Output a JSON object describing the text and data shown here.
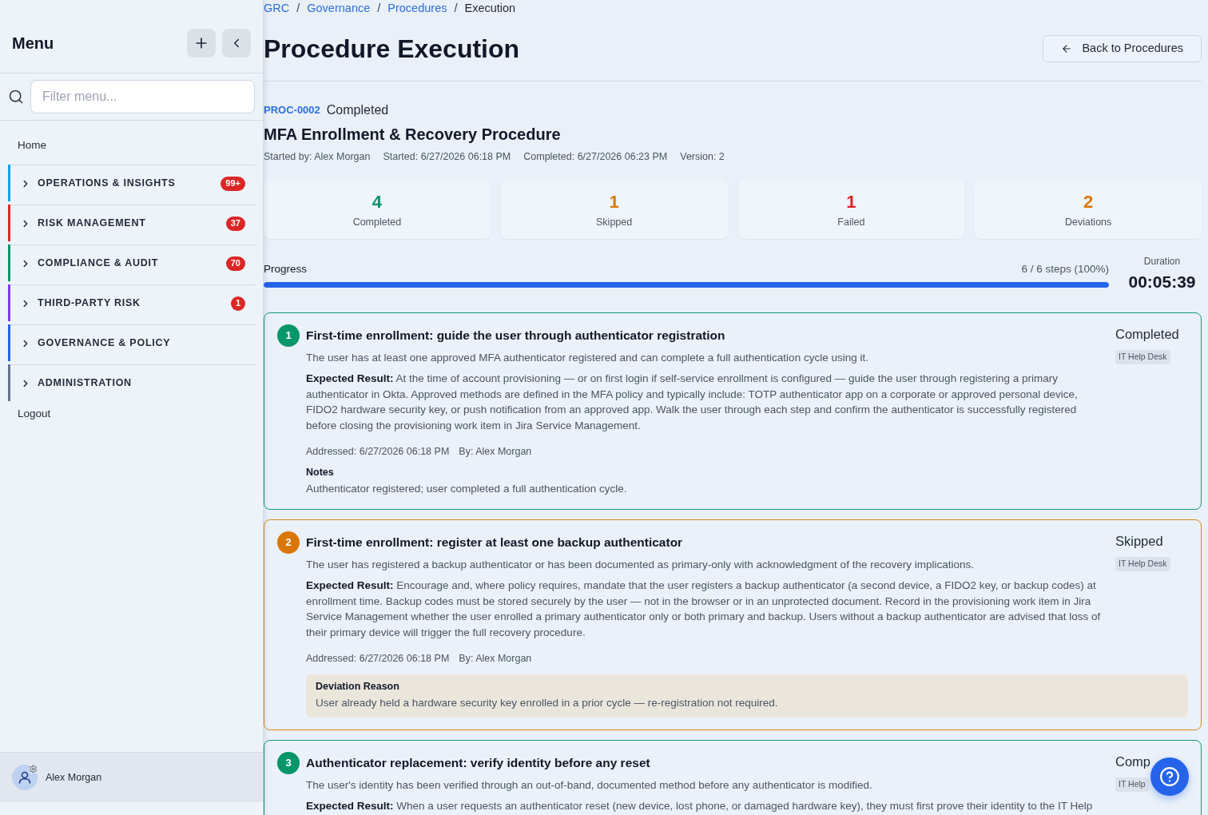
{
  "sidebar": {
    "title": "Menu",
    "filter": {
      "placeholder": "Filter menu..."
    },
    "items": [
      {
        "kind": "link",
        "label": "Home"
      },
      {
        "kind": "section",
        "label": "OPERATIONS & INSIGHTS",
        "badge": "99+",
        "color": "#0ea5e9",
        "expanded": false
      },
      {
        "kind": "section",
        "label": "RISK MANAGEMENT",
        "badge": "37",
        "color": "#dc2626",
        "expanded": false
      },
      {
        "kind": "section",
        "label": "COMPLIANCE & AUDIT",
        "badge": "70",
        "color": "#059669",
        "expanded": false
      },
      {
        "kind": "section",
        "label": "THIRD-PARTY RISK",
        "badge": "1",
        "color": "#7c3aed",
        "expanded": false
      },
      {
        "kind": "section",
        "label": "GOVERNANCE & POLICY",
        "color": "#2563eb",
        "expanded": false
      },
      {
        "kind": "section",
        "label": "ADMINISTRATION",
        "color": "#64748b",
        "expanded": false
      },
      {
        "kind": "link",
        "label": "Logout"
      }
    ],
    "user": {
      "name": "Alex Morgan"
    }
  },
  "breadcrumb": [
    {
      "kind": "link",
      "label": "GRC"
    },
    {
      "kind": "separator",
      "label": "/"
    },
    {
      "kind": "link",
      "label": "Governance"
    },
    {
      "kind": "separator",
      "label": "/"
    },
    {
      "kind": "link",
      "label": "Procedures"
    },
    {
      "kind": "separator",
      "label": "/"
    },
    {
      "kind": "current",
      "label": "Execution"
    }
  ],
  "page": {
    "title": "Procedure Execution",
    "back_button": "Back to Procedures"
  },
  "procedure": {
    "id": "PROC-0002",
    "status": "Completed",
    "title": "MFA Enrollment & Recovery Procedure",
    "meta": [
      "Started by: Alex Morgan",
      "Started: 6/27/2026 06:18 PM",
      "Completed: 6/27/2026 06:23 PM",
      "Version: 2"
    ]
  },
  "stats": [
    {
      "value": "4",
      "label": "Completed",
      "color": "#059669"
    },
    {
      "value": "1",
      "label": "Skipped",
      "color": "#d97706"
    },
    {
      "value": "1",
      "label": "Failed",
      "color": "#dc2626"
    },
    {
      "value": "2",
      "label": "Deviations",
      "color": "#d97706"
    }
  ],
  "progress": {
    "label": "Progress",
    "reading": "6 / 6 steps (100%)",
    "level": 1,
    "duration_label": "Duration",
    "duration": "00:05:39"
  },
  "steps": [
    {
      "kind": "completed",
      "number": "1",
      "title": "First-time enrollment: guide the user through authenticator registration",
      "description": "The user has at least one approved MFA authenticator registered and can complete a full authentication cycle using it.",
      "expected": "**Expected Result:** At the time of account provisioning — or on first login if self-service enrollment is configured — guide the user through registering a primary authenticator in Okta. Approved methods are defined in the MFA policy and typically include: TOTP authenticator app on a corporate or approved personal device, FIDO2 hardware security key, or push notification from an approved app. Walk the user through each step and confirm the authenticator is successfully registered before closing the provisioning work item in Jira Service Management.",
      "addressed": "Addressed: 6/27/2026 06:18 PM",
      "by": "By: Alex Morgan",
      "notes": {
        "label": "Notes",
        "text": "Authenticator registered; user completed a full authentication cycle."
      },
      "status_label": "Completed",
      "tag": "IT Help Desk"
    },
    {
      "kind": "skipped",
      "number": "2",
      "title": "First-time enrollment: register at least one backup authenticator",
      "description": "The user has registered a backup authenticator or has been documented as primary-only with acknowledgment of the recovery implications.",
      "expected": "**Expected Result:** Encourage and, where policy requires, mandate that the user registers a backup authenticator (a second device, a FIDO2 key, or backup codes) at enrollment time. Backup codes must be stored securely by the user — not in the browser or in an unprotected document. Record in the provisioning work item in Jira Service Management whether the user enrolled a primary authenticator only or both primary and backup. Users without a backup authenticator are advised that loss of their primary device will trigger the full recovery procedure.",
      "addressed": "Addressed: 6/27/2026 06:18 PM",
      "by": "By: Alex Morgan",
      "deviation": {
        "label": "Deviation Reason",
        "text": "User already held a hardware security key enrolled in a prior cycle — re-registration not required."
      },
      "status_label": "Skipped",
      "tag": "IT Help Desk"
    },
    {
      "kind": "completed",
      "number": "3",
      "title": "Authenticator replacement: verify identity before any reset",
      "description": "The user's identity has been verified through an out-of-band, documented method before any authenticator is modified.",
      "expected": "**Expected Result:** When a user requests an authenticator reset (new device, lost phone, or damaged hardware key), they must first prove their identity to the IT Help",
      "status_label": "Comp",
      "tag": "IT Help"
    }
  ]
}
